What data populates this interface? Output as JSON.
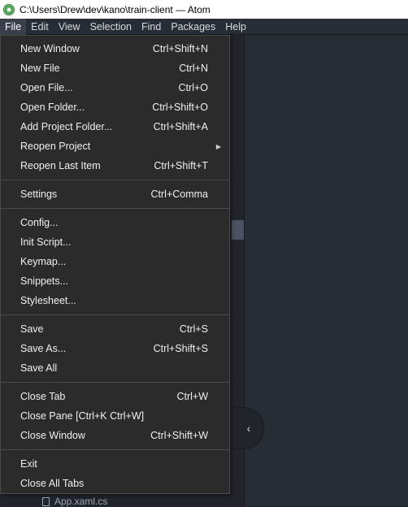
{
  "window": {
    "title": "C:\\Users\\Drew\\dev\\kano\\train-client — Atom"
  },
  "menubar": [
    {
      "label": "File"
    },
    {
      "label": "Edit"
    },
    {
      "label": "View"
    },
    {
      "label": "Selection"
    },
    {
      "label": "Find"
    },
    {
      "label": "Packages"
    },
    {
      "label": "Help"
    }
  ],
  "file_menu": {
    "groups": [
      [
        {
          "label": "New Window",
          "shortcut": "Ctrl+Shift+N"
        },
        {
          "label": "New File",
          "shortcut": "Ctrl+N"
        },
        {
          "label": "Open File...",
          "shortcut": "Ctrl+O"
        },
        {
          "label": "Open Folder...",
          "shortcut": "Ctrl+Shift+O"
        },
        {
          "label": "Add Project Folder...",
          "shortcut": "Ctrl+Shift+A"
        },
        {
          "label": "Reopen Project",
          "shortcut": ""
        },
        {
          "label": "Reopen Last Item",
          "shortcut": "Ctrl+Shift+T"
        }
      ],
      [
        {
          "label": "Settings",
          "shortcut": "Ctrl+Comma"
        }
      ],
      [
        {
          "label": "Config...",
          "shortcut": ""
        },
        {
          "label": "Init Script...",
          "shortcut": ""
        },
        {
          "label": "Keymap...",
          "shortcut": ""
        },
        {
          "label": "Snippets...",
          "shortcut": ""
        },
        {
          "label": "Stylesheet...",
          "shortcut": ""
        }
      ],
      [
        {
          "label": "Save",
          "shortcut": "Ctrl+S"
        },
        {
          "label": "Save As...",
          "shortcut": "Ctrl+Shift+S"
        },
        {
          "label": "Save All",
          "shortcut": ""
        }
      ],
      [
        {
          "label": "Close Tab",
          "shortcut": "Ctrl+W"
        },
        {
          "label": "Close Pane [Ctrl+K Ctrl+W]",
          "shortcut": ""
        },
        {
          "label": "Close Window",
          "shortcut": "Ctrl+Shift+W"
        }
      ],
      [
        {
          "label": "Exit",
          "shortcut": ""
        },
        {
          "label": "Close All Tabs",
          "shortcut": ""
        }
      ]
    ]
  },
  "tree_view": {
    "partial_file": "App.xaml.cs"
  },
  "icons": {
    "app": "atom-logo-icon",
    "submenu": "chevron-right-icon",
    "toggle": "chevron-left-icon",
    "file": "file-icon"
  }
}
